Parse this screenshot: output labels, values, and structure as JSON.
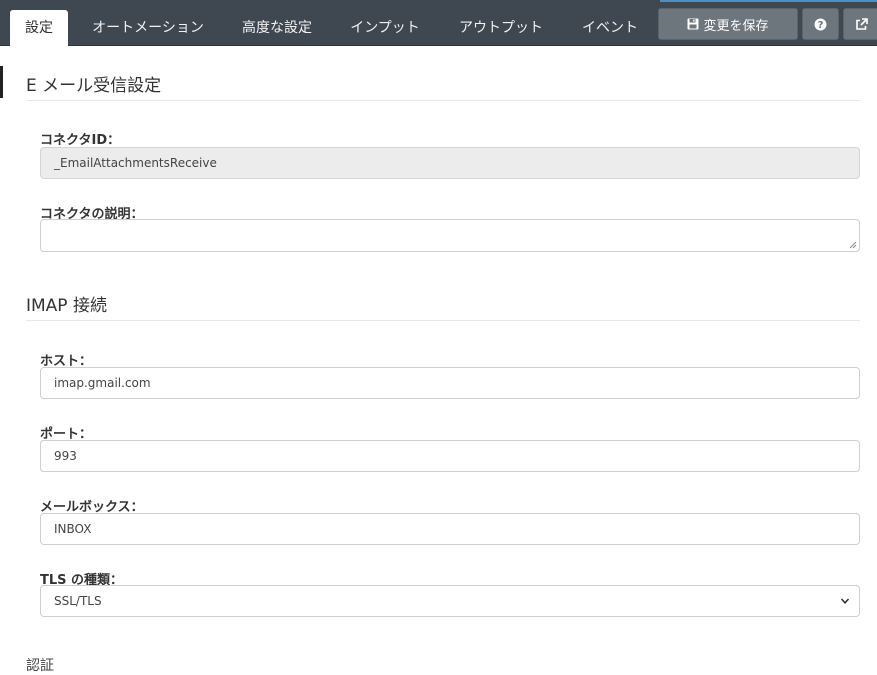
{
  "tabs": [
    {
      "label": "設定",
      "active": true
    },
    {
      "label": "オートメーション",
      "active": false
    },
    {
      "label": "高度な設定",
      "active": false
    },
    {
      "label": "インプット",
      "active": false
    },
    {
      "label": "アウトプット",
      "active": false
    },
    {
      "label": "イベント",
      "active": false
    }
  ],
  "toolbar": {
    "save_label": "変更を保存",
    "save_icon": "floppy-disk-icon",
    "help_icon": "question-circle-icon",
    "external_icon": "external-link-icon"
  },
  "sections": {
    "email": {
      "title": "E メール受信設定",
      "connector_id_label": "コネクタID：",
      "connector_id_value": "_EmailAttachmentsReceive",
      "description_label": "コネクタの説明：",
      "description_value": ""
    },
    "imap": {
      "title": "IMAP 接続",
      "host_label": "ホスト：",
      "host_value": "imap.gmail.com",
      "port_label": "ポート：",
      "port_value": "993",
      "mailbox_label": "メールボックス：",
      "mailbox_value": "INBOX",
      "tls_label": "TLS の種類：",
      "tls_value": "SSL/TLS"
    },
    "auth": {
      "title": "認証"
    }
  },
  "colors": {
    "topbar": "#3f4750",
    "button": "#6d757d",
    "readonly_bg": "#ececec"
  }
}
